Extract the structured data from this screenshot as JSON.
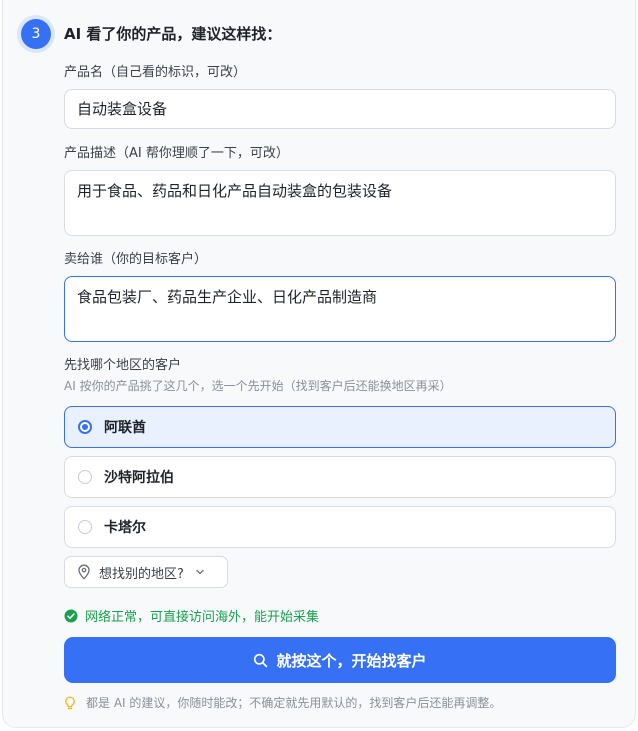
{
  "step": {
    "number": "3",
    "title": "AI 看了你的产品，建议这样找："
  },
  "product_name": {
    "label": "产品名（自己看的标识，可改）",
    "value": "自动装盒设备"
  },
  "product_desc": {
    "label": "产品描述（AI 帮你理顺了一下，可改）",
    "value": "用于食品、药品和日化产品自动装盒的包装设备"
  },
  "target_customer": {
    "label": "卖给谁（你的目标客户）",
    "value": "食品包装厂、药品生产企业、日化产品制造商"
  },
  "region": {
    "label": "先找哪个地区的客户",
    "hint": "AI 按你的产品挑了这几个，选一个先开始（找到客户后还能换地区再采）",
    "options": [
      {
        "label": "阿联酋",
        "selected": true
      },
      {
        "label": "沙特阿拉伯",
        "selected": false
      },
      {
        "label": "卡塔尔",
        "selected": false
      }
    ],
    "other_label": "想找别的地区?"
  },
  "status": {
    "text": "网络正常，可直接访问海外，能开始采集",
    "icon": "check-circle-icon",
    "color": "#19a04d"
  },
  "primary_button": {
    "label": "就按这个，开始找客户",
    "icon": "search-icon"
  },
  "footer_tip": "都是 AI 的建议，你随时能改；不确定就先用默认的，找到客户后还能再调整。",
  "colors": {
    "accent": "#3570f5",
    "success": "#19a04d",
    "tip_icon": "#f5b400"
  }
}
